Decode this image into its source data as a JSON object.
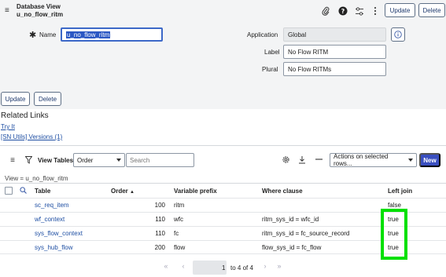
{
  "header": {
    "title_line1": "Database View",
    "title_line2": "u_no_flow_ritm",
    "update_label": "Update",
    "delete_label": "Delete"
  },
  "form": {
    "name_label": "Name",
    "name_value": "u_no_flow_ritm",
    "application_label": "Application",
    "application_value": "Global",
    "label_label": "Label",
    "label_value": "No Flow RITM",
    "plural_label": "Plural",
    "plural_value": "No Flow RITMs",
    "update_label": "Update",
    "delete_label": "Delete"
  },
  "related_links": {
    "title": "Related Links",
    "links": [
      "Try It",
      "[SN Utils] Versions (1)"
    ]
  },
  "list": {
    "title": "View Tables",
    "filter_field": "Order",
    "search_placeholder": "Search",
    "actions_label": "Actions on selected rows...",
    "new_label": "New",
    "breadcrumb": "View = u_no_flow_ritm",
    "columns": {
      "table": "Table",
      "order": "Order",
      "variable_prefix": "Variable prefix",
      "where_clause": "Where clause",
      "left_join": "Left join"
    },
    "rows": [
      {
        "table": "sc_req_item",
        "order": "100",
        "prefix": "ritm",
        "where": "",
        "left_join": "false"
      },
      {
        "table": "wf_context",
        "order": "110",
        "prefix": "wfc",
        "where": "ritm_sys_id = wfc_id",
        "left_join": "true"
      },
      {
        "table": "sys_flow_context",
        "order": "110",
        "prefix": "fc",
        "where": "ritm_sys_id = fc_source_record",
        "left_join": "true"
      },
      {
        "table": "sys_hub_flow",
        "order": "200",
        "prefix": "flow",
        "where": "flow_sys_id = fc_flow",
        "left_join": "true"
      }
    ],
    "pagination": {
      "current": "1",
      "range_text": "to 4 of 4"
    }
  },
  "colors": {
    "accent": "#3a4fc0",
    "link": "#1f4fa3",
    "highlight": "#00e000"
  }
}
